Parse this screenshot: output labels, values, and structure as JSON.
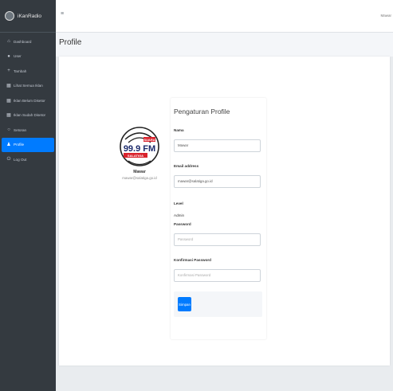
{
  "brand": {
    "name": "iKanRadio"
  },
  "sidebar": {
    "items": [
      {
        "label": "Dashboard",
        "icon": "home-icon"
      },
      {
        "label": "User",
        "icon": "users-icon"
      },
      {
        "label": "Tambah",
        "icon": "plus-icon"
      },
      {
        "label": "Lihat Semua Iklan",
        "icon": "list-icon"
      },
      {
        "label": "Iklan Belum Disetor",
        "icon": "list-icon"
      },
      {
        "label": "Iklan Sudah Disetor",
        "icon": "list-icon"
      },
      {
        "label": "Setoran",
        "icon": "circle-icon"
      },
      {
        "label": "Profile",
        "icon": "user-icon",
        "active": true
      },
      {
        "label": "Log Out",
        "icon": "power-icon"
      }
    ]
  },
  "topbar": {
    "menu_icon": "≡",
    "user_short": "Mawar"
  },
  "page": {
    "title": "Profile"
  },
  "profile": {
    "name": "Mawar",
    "email": "mawar@salatiga.go.id",
    "logo": {
      "top_text": "SUARA",
      "main_text": "99.9 FM",
      "bottom_text": "SALATIGA"
    }
  },
  "form": {
    "title": "Pengaturan Profile",
    "name_label": "Nama",
    "name_value": "Mawar",
    "email_label": "Email address",
    "email_value": "mawar@salatiga.go.id",
    "level_label": "Level",
    "level_value": "Admin",
    "password_label": "Password",
    "password_placeholder": "Password",
    "confirm_label": "Konfirmasi Password",
    "confirm_placeholder": "Konfirmasi Password",
    "save_label": "Simpan"
  },
  "colors": {
    "sidebar": "#343a40",
    "accent": "#007bff"
  }
}
